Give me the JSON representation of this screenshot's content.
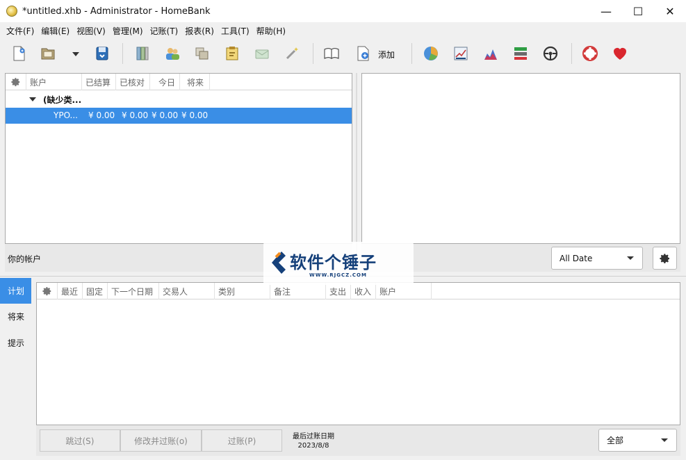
{
  "window": {
    "title": "*untitled.xhb - Administrator - HomeBank",
    "minimize": "—",
    "maximize": "☐",
    "close": "✕"
  },
  "menu": [
    "文件(F)",
    "编辑(E)",
    "视图(V)",
    "管理(M)",
    "记账(T)",
    "报表(R)",
    "工具(T)",
    "帮助(H)"
  ],
  "toolbar": {
    "add_label": "添加"
  },
  "accounts": {
    "columns": [
      "账户",
      "已结算",
      "已核对",
      "今日",
      "将来"
    ],
    "group": "(缺少类...",
    "row": {
      "name": "YPO...",
      "cleared": "¥ 0.00",
      "reconciled": "¥ 0.00",
      "today": "¥ 0.00",
      "future": "¥ 0.00"
    },
    "footer": "你的帐户"
  },
  "right_panel": {
    "date_filter": "All Date"
  },
  "schedule": {
    "tabs": [
      "计划",
      "将来",
      "提示"
    ],
    "columns": [
      "最近",
      "固定",
      "下一个日期",
      "交易人",
      "类别",
      "备注",
      "支出",
      "收入",
      "账户"
    ],
    "buttons": {
      "skip": "跳过(S)",
      "edit_post": "修改并过账(o)",
      "post": "过账(P)"
    },
    "last_post_label": "最后过账日期",
    "last_post_date": "2023/8/8",
    "filter": "全部"
  },
  "watermark": {
    "title": "软件个锤子",
    "sub": "WWW.RJGCZ.COM"
  },
  "colors": {
    "selection": "#3a8ee6",
    "watermark": "#15407a"
  }
}
